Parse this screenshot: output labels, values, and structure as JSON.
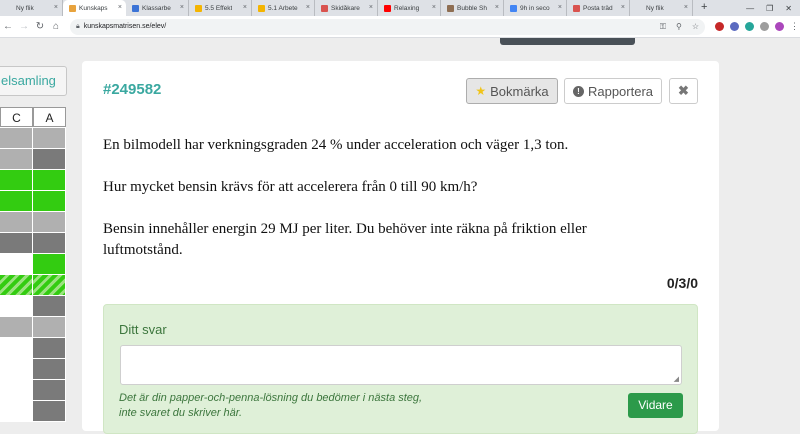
{
  "browser": {
    "tabs": [
      {
        "title": "Ny flik",
        "color": "#dee1e6"
      },
      {
        "title": "Kunskaps",
        "color": "#e8a33d"
      },
      {
        "title": "Klassarbe",
        "color": "#3b73d6"
      },
      {
        "title": "5.5 Effekt",
        "color": "#f4b400"
      },
      {
        "title": "5.1 Arbete",
        "color": "#f4b400"
      },
      {
        "title": "Skidåkare",
        "color": "#d9534f"
      },
      {
        "title": "Relaxing",
        "color": "#ff0000"
      },
      {
        "title": "Bubble Sh",
        "color": "#8e6e53"
      },
      {
        "title": "9h in seco",
        "color": "#4285f4"
      },
      {
        "title": "Posta träd",
        "color": "#d9534f"
      },
      {
        "title": "Ny flik",
        "color": "#dee1e6"
      }
    ],
    "new_tab": "+",
    "url": "kunskapsmatrisen.se/elev/"
  },
  "sidebar": {
    "button_label": "elsamling",
    "matrix_headers": [
      "C",
      "A"
    ],
    "matrix_rows": [
      [
        "#b0b0b0",
        "#b0b0b0"
      ],
      [
        "#b0b0b0",
        "#7a7a7a"
      ],
      [
        "#33cc11",
        "#33cc11"
      ],
      [
        "#33cc11",
        "#33cc11"
      ],
      [
        "#b0b0b0",
        "#b0b0b0"
      ],
      [
        "#7a7a7a",
        "#7a7a7a"
      ],
      [
        "#ffffff",
        "#33cc11"
      ],
      [
        "hatch",
        "hatch"
      ],
      [
        "#ffffff",
        "#7a7a7a"
      ],
      [
        "#b0b0b0",
        "#b0b0b0"
      ],
      [
        "#ffffff",
        "#7a7a7a"
      ],
      [
        "#ffffff",
        "#7a7a7a"
      ],
      [
        "#ffffff",
        "#7a7a7a"
      ],
      [
        "#ffffff",
        "#7a7a7a"
      ]
    ]
  },
  "task": {
    "id": "#249582",
    "bookmark_label": "Bokmärka",
    "report_label": "Rapportera",
    "close_label": "✖",
    "paragraphs": [
      "En bilmodell har verkningsgraden 24 % under acceleration och väger 1,3 ton.",
      "Hur mycket bensin krävs för att accelerera från 0 till 90 km/h?",
      "Bensin innehåller energin 29 MJ per liter. Du behöver inte räkna på friktion eller luftmotstånd."
    ],
    "score": "0/3/0"
  },
  "answer": {
    "label": "Ditt svar",
    "value": "",
    "hint_line1": "Det är din papper-och-penna-lösning du bedömer i nästa steg,",
    "hint_line2": "inte svaret du skriver här.",
    "next_label": "Vidare"
  },
  "colors": {
    "accent": "#3aa8a0",
    "success": "#2c9a4a",
    "matrix_green": "#33cc11"
  }
}
